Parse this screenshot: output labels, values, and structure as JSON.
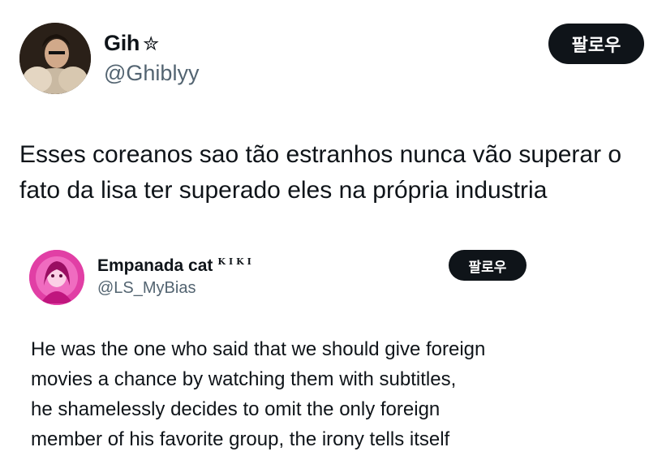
{
  "tweet1": {
    "display_name": "Gih",
    "name_suffix": "✮",
    "handle": "@Ghiblyy",
    "follow_label": "팔로우",
    "text": "Esses coreanos sao tão estranhos nunca vão superar o fato da lisa ter superado eles na própria industria"
  },
  "tweet2": {
    "display_name": "Empanada cat",
    "name_badge": "KIKI",
    "handle": "@LS_MyBias",
    "follow_label": "팔로우",
    "text_lines": [
      "He was the one who said that we should give foreign",
      "movies a chance by watching them with subtitles,",
      "he shamelessly decides to omit the only foreign",
      "member of his favorite group, the irony tells itself"
    ]
  },
  "colors": {
    "text": "#0f1419",
    "secondary_text": "#536471",
    "button_bg": "#0f1419",
    "button_text": "#ffffff",
    "avatar2_bg": "#e13fa5"
  }
}
